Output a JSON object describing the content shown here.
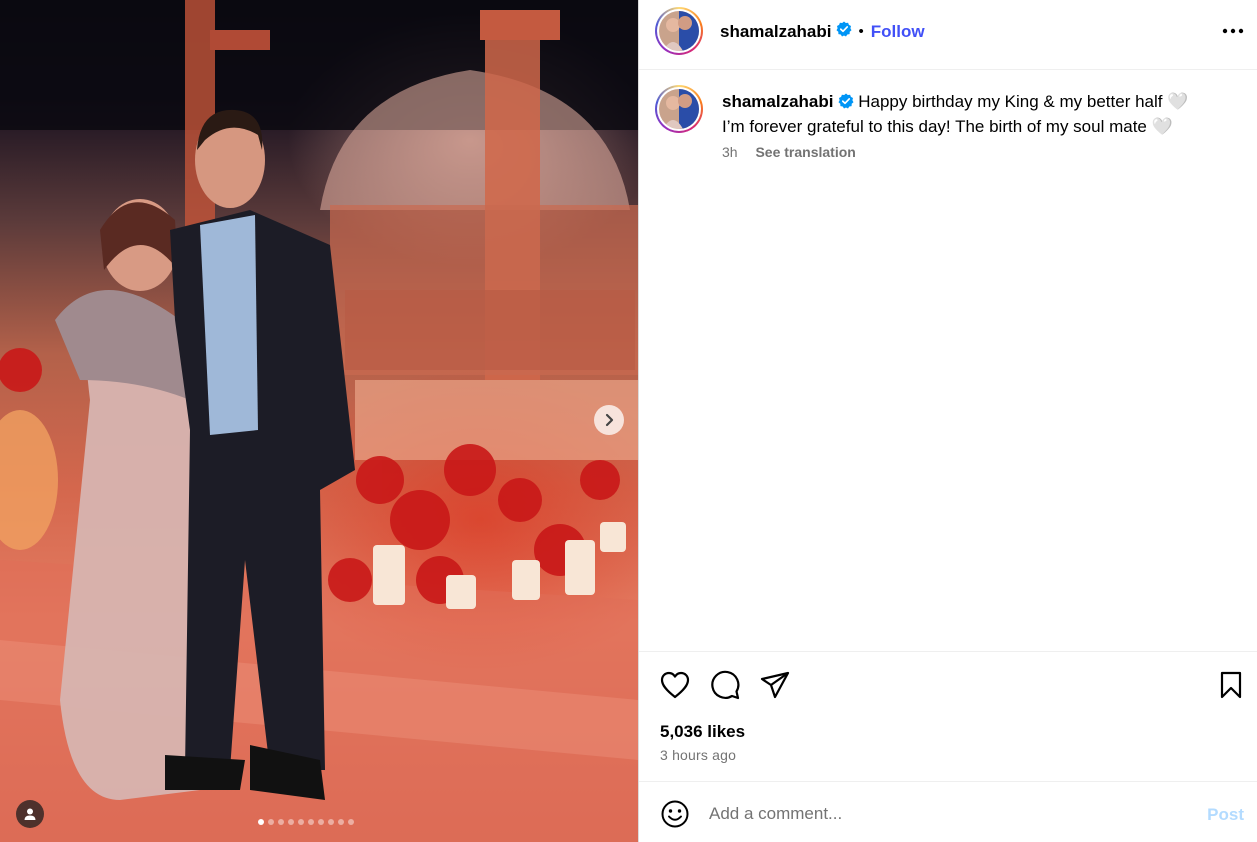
{
  "post": {
    "author": {
      "username": "shamalzahabi",
      "verified": true,
      "follow_label": "Follow",
      "separator": "•"
    },
    "caption": {
      "line1": "Happy birthday my King & my better half 🤍",
      "line2": "I’m forever grateful to this day! The birth of my soul mate 🤍",
      "time": "3h",
      "see_translation": "See translation"
    },
    "likes": "5,036 likes",
    "time_ago": "3 hours ago",
    "carousel": {
      "total": 10,
      "active_index": 0
    }
  },
  "comment": {
    "placeholder": "Add a comment...",
    "post_label": "Post"
  },
  "icons": {
    "more": "more-horizontal-icon",
    "like": "heart-icon",
    "comment": "comment-bubble-icon",
    "share": "paper-plane-icon",
    "save": "bookmark-icon",
    "emoji": "emoji-smile-icon",
    "next": "chevron-right-icon",
    "tags": "user-tag-icon",
    "verified": "verified-badge-icon"
  },
  "colors": {
    "follow": "#4150f7",
    "verified": "#0095f6",
    "secondary_text": "#737373",
    "post_disabled": "#b3dbff"
  }
}
